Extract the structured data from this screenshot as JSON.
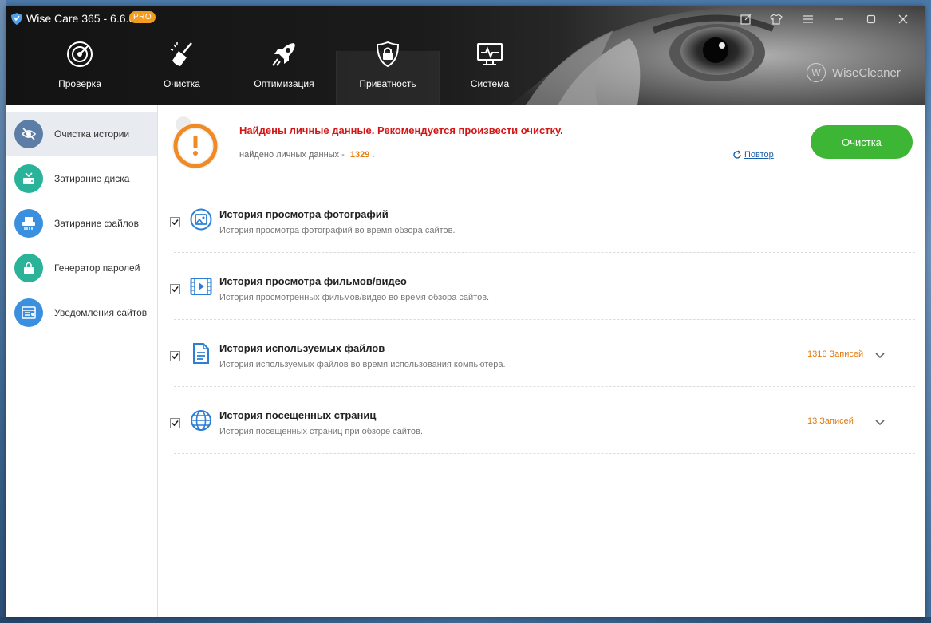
{
  "app": {
    "title": "Wise Care 365 - 6.6.6",
    "badge": "PRO",
    "brand": "WiseCleaner",
    "brand_mark": "W"
  },
  "nav": [
    {
      "label": "Проверка",
      "icon": "radar-icon"
    },
    {
      "label": "Очистка",
      "icon": "broom-icon"
    },
    {
      "label": "Оптимизация",
      "icon": "rocket-icon"
    },
    {
      "label": "Приватность",
      "icon": "privacy-lock-icon",
      "active": true
    },
    {
      "label": "Система",
      "icon": "monitor-icon"
    }
  ],
  "sidebar": [
    {
      "label": "Очистка истории",
      "icon": "eye-off-icon",
      "color": "#5b7da6",
      "active": true
    },
    {
      "label": "Затирание диска",
      "icon": "disk-wipe-icon",
      "color": "#2bb39a"
    },
    {
      "label": "Затирание файлов",
      "icon": "shredder-icon",
      "color": "#3a8fde"
    },
    {
      "label": "Генератор паролей",
      "icon": "lock-icon",
      "color": "#2bb39a"
    },
    {
      "label": "Уведомления сайтов",
      "icon": "notification-icon",
      "color": "#3a8fde"
    }
  ],
  "alert": {
    "title": "Найдены личные данные. Рекомендуется произвести очистку.",
    "found_label": "найдено личных данных -",
    "found_count": "1329",
    "found_suffix": ".",
    "retry_label": "Повтор",
    "clean_label": "Очистка"
  },
  "items": [
    {
      "title": "История просмотра фотографий",
      "desc": "История просмотра фотографий во время обзора сайтов.",
      "count": "",
      "checked": true,
      "icon": "photo-icon"
    },
    {
      "title": "История просмотра фильмов/видео",
      "desc": "История просмотренных фильмов/видео во время обзора сайтов.",
      "count": "",
      "checked": true,
      "icon": "video-icon"
    },
    {
      "title": "История используемых файлов",
      "desc": "История используемых файлов во время использования компьютера.",
      "count": "1316 Записей",
      "checked": true,
      "icon": "document-icon"
    },
    {
      "title": "История посещенных страниц",
      "desc": "История посещенных страниц при обзоре сайтов.",
      "count": "13 Записей",
      "checked": true,
      "icon": "globe-icon"
    }
  ],
  "colors": {
    "accent_green": "#3cb634",
    "alert_red": "#d41616",
    "count_orange": "#e07b10",
    "link_blue": "#1c5fa8"
  }
}
